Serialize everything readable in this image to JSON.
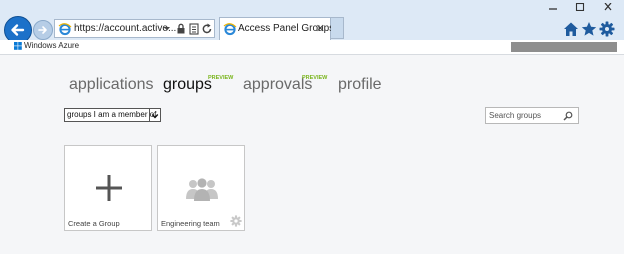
{
  "browser": {
    "address_text": "https://account.active...",
    "tab_title": "Access Panel Groups",
    "tab_close": "✕",
    "accent": "#1c71c9"
  },
  "header": {
    "brand": "Windows Azure"
  },
  "nav": {
    "items": [
      {
        "label": "applications",
        "badge": ""
      },
      {
        "label": "groups",
        "badge": "PREVIEW",
        "active": true
      },
      {
        "label": "approvals",
        "badge": "PREVIEW"
      },
      {
        "label": "profile",
        "badge": ""
      }
    ]
  },
  "filter": {
    "selected": "groups I am a member of"
  },
  "search": {
    "placeholder": "Search groups"
  },
  "tiles": [
    {
      "label": "Create a Group",
      "icon": "plus-icon"
    },
    {
      "label": "Engineering team",
      "icon": "group-icon"
    }
  ],
  "colors": {
    "preview_badge": "#7ab51d",
    "chrome_bg": "#dde9f6"
  }
}
